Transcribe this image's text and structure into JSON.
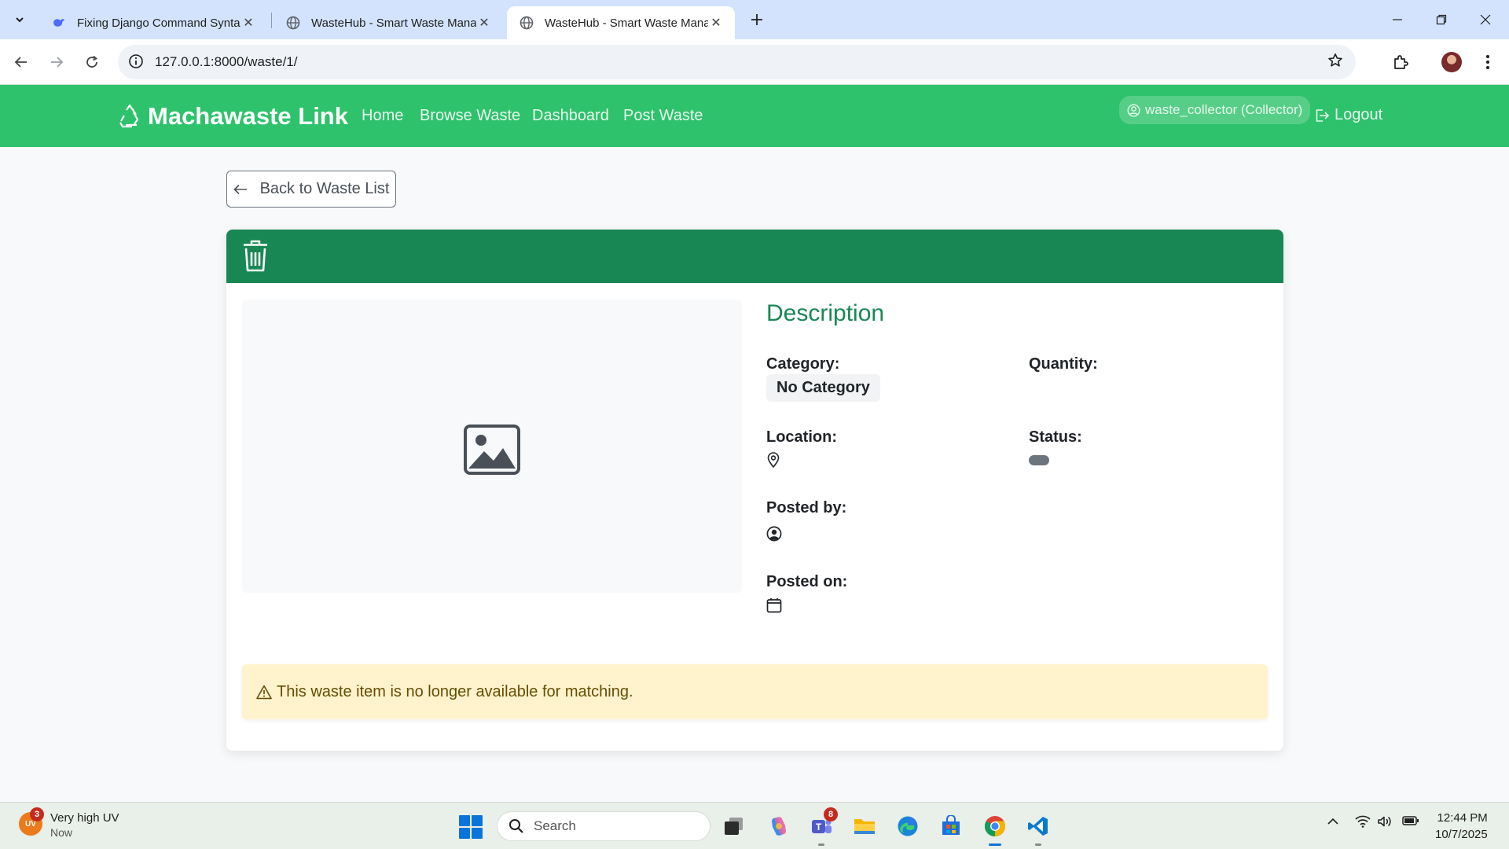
{
  "browser": {
    "tabs": [
      {
        "title": "Fixing Django Command Synta",
        "active": false
      },
      {
        "title": "WasteHub - Smart Waste Mana",
        "active": false
      },
      {
        "title": "WasteHub - Smart Waste Mana",
        "active": true
      }
    ],
    "url": "127.0.0.1:8000/waste/1/"
  },
  "navbar": {
    "brand": "Machawaste Link",
    "links": [
      "Home",
      "Browse Waste",
      "Dashboard",
      "Post Waste"
    ],
    "user": "waste_collector (Collector)",
    "logout": "Logout",
    "color": "#2dc26b"
  },
  "page": {
    "back_label": "Back to Waste List",
    "header_color": "#198754",
    "description_title": "Description",
    "fields": {
      "category_label": "Category:",
      "category_value": "No Category",
      "quantity_label": "Quantity:",
      "location_label": "Location:",
      "status_label": "Status:",
      "posted_by_label": "Posted by:",
      "posted_on_label": "Posted on:"
    },
    "alert": "This waste item is no longer available for matching."
  },
  "taskbar": {
    "weather_title": "Very high UV",
    "weather_sub": "Now",
    "weather_badge": "3",
    "weather_icon_text": "UV",
    "search_placeholder": "Search",
    "teams_badge": "8",
    "time": "12:44 PM",
    "date": "10/7/2025"
  }
}
